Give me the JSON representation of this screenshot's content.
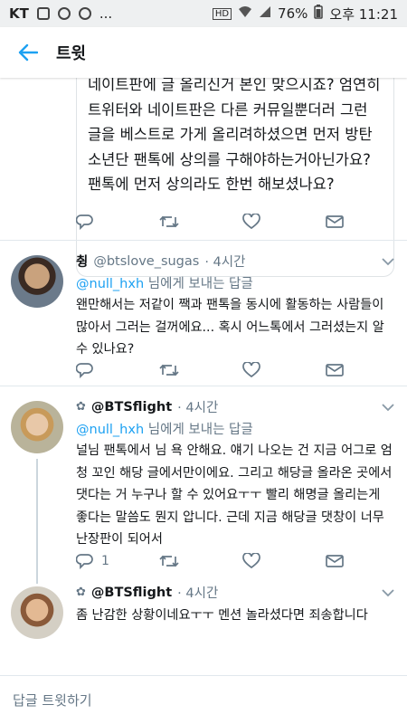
{
  "status_bar": {
    "carrier": "KT",
    "more": "...",
    "battery": "76%",
    "time": "오후 11:21"
  },
  "app_bar": {
    "title": "트윗"
  },
  "quoted_text": "네이트판에 글 올리신거 본인 맞으시죠? 엄연히 트위터와 네이트판은 다른 커뮤일뿐더러 그런 글을 베스트로 가게 올리려하셨으면 먼저 방탄소년단 팬톡에 상의를 구해야하는거아닌가요? 팬톡에 먼저 상의라도 한번 해보셨나요?",
  "tweets": [
    {
      "name": "췽",
      "handle": "@btslove_sugas",
      "time": "· 4시간",
      "reply_to": "@null_hxh",
      "reply_suffix": "님에게 보내는 답글",
      "text": "왠만해서는 저같이 짹과 팬톡을 동시에 활동하는 사람들이 많아서 그러는 걸꺼에요... 혹시 어느톡에서 그러셨는지 알수 있나요?",
      "reply_count": ""
    },
    {
      "name": "@BTSflight",
      "handle": "",
      "time": "· 4시간",
      "reply_to": "@null_hxh",
      "reply_suffix": "님에게 보내는 답글",
      "text": "널님 팬톡에서 님 욕 안해요. 얘기 나오는 건 지금 어그로 엄청 꼬인 해당 글에서만이에요. 그리고 해당글 올라온 곳에서 댓다는 거 누구나 할 수 있어요ㅜㅜ 빨리 해명글 올리는게 좋다는 말씀도 뭔지 압니다. 근데 지금 해당글 댓창이 너무 난장판이 되어서",
      "reply_count": "1"
    },
    {
      "name": "@BTSflight",
      "handle": "",
      "time": "· 4시간",
      "text": "좀 난감한 상황이네요ㅜㅜ 멘션 놀라셨다면 죄송합니다"
    }
  ],
  "reply_bar": {
    "placeholder": "답글 트윗하기"
  },
  "colors": {
    "accent": "#1da1f2",
    "secondary": "#657786",
    "divider": "#e1e8ed"
  }
}
